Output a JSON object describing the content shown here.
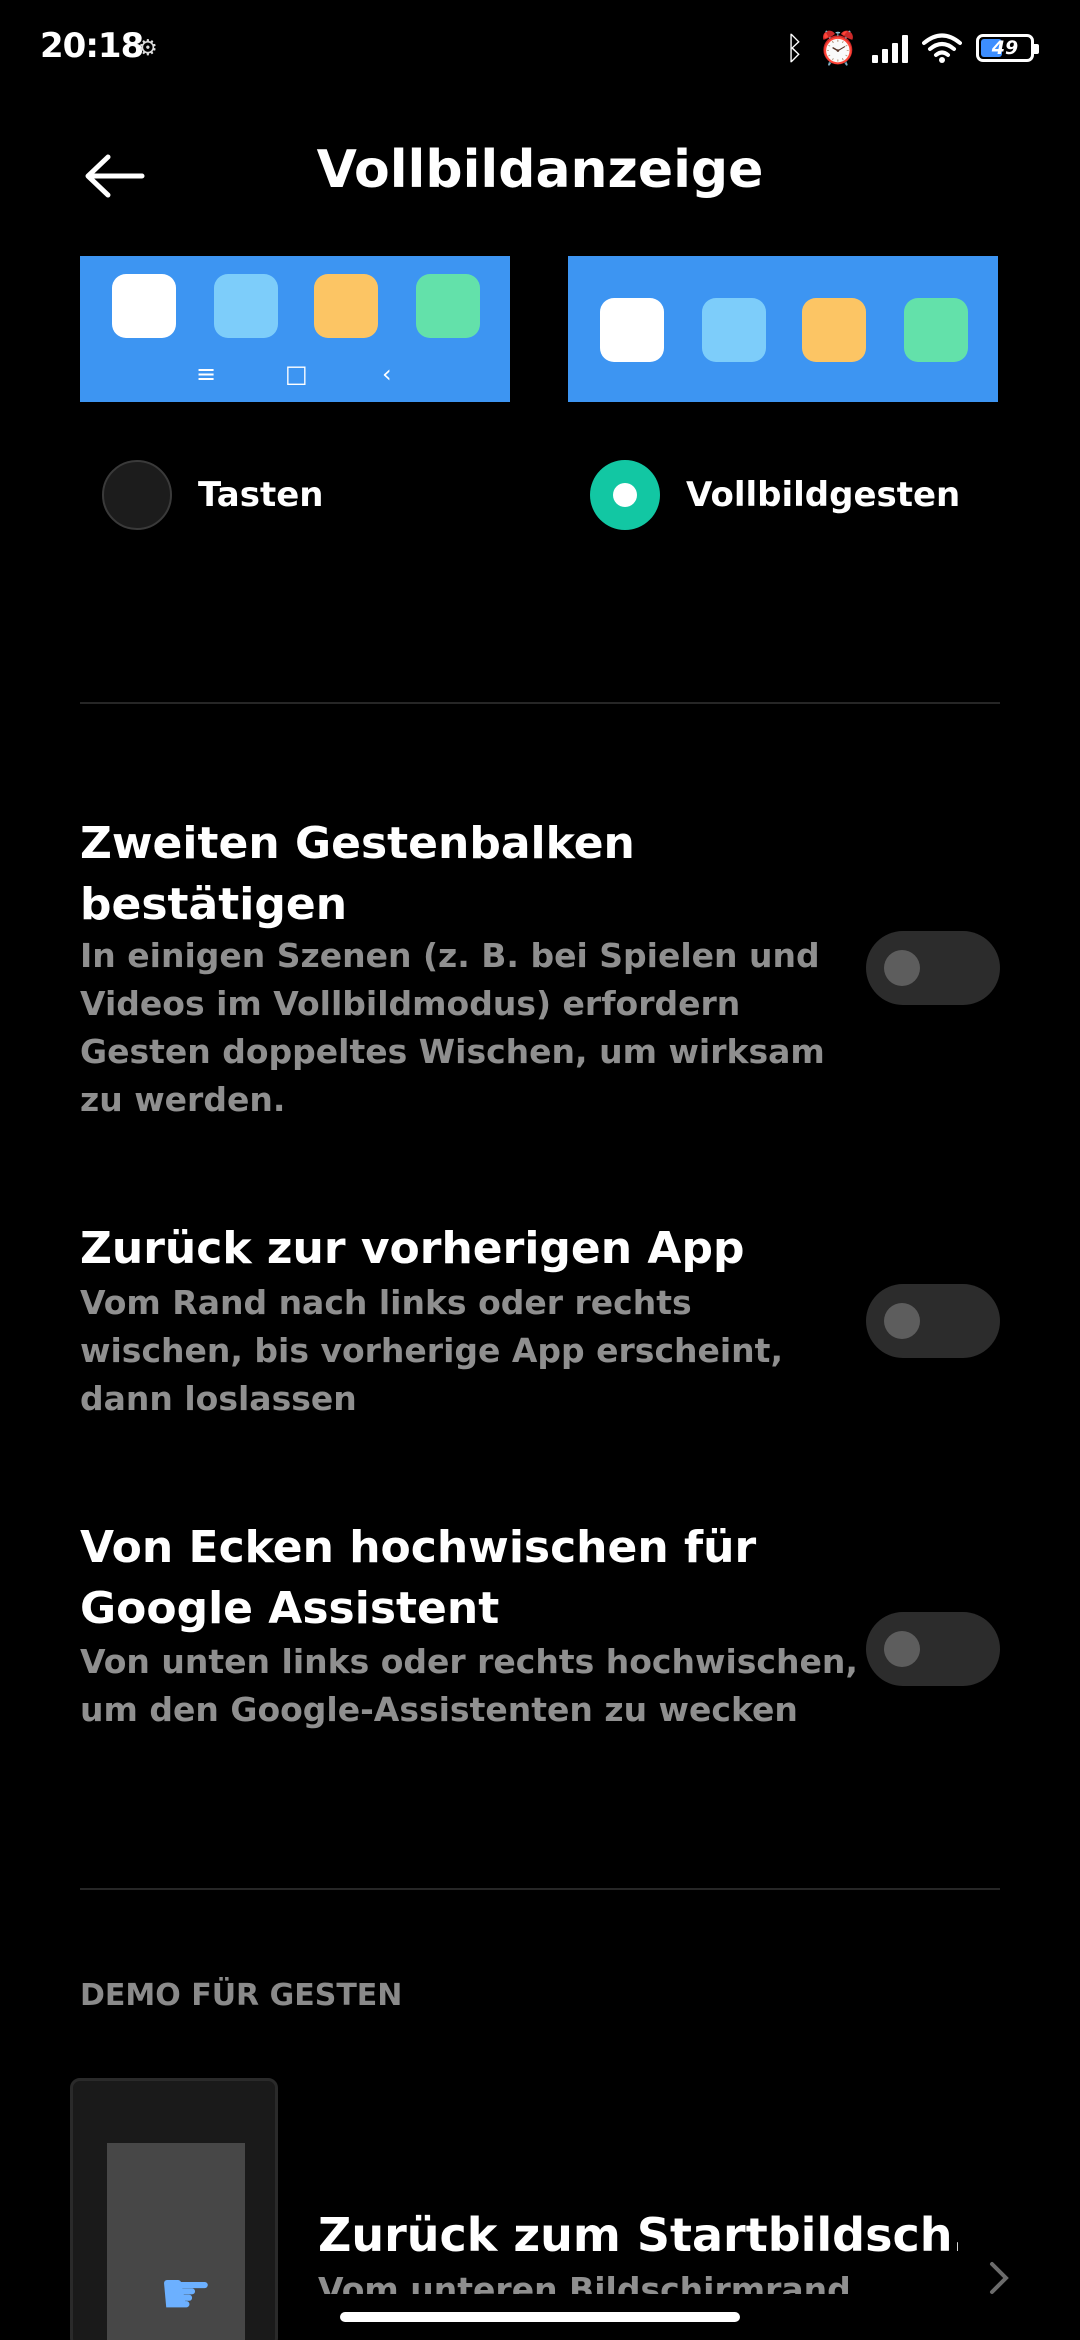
{
  "status_bar": {
    "time": "20:18",
    "battery_level": "49",
    "icons": [
      "bluetooth-icon",
      "alarm-icon",
      "signal-icon",
      "wifi-icon",
      "battery-icon"
    ]
  },
  "header": {
    "title": "Vollbildanzeige",
    "back_icon": "arrow-left-icon"
  },
  "navigation_mode": {
    "options": [
      {
        "label": "Tasten",
        "selected": false
      },
      {
        "label": "Vollbildgesten",
        "selected": true
      }
    ],
    "preview_nav_keys": [
      "≡",
      "□",
      "‹"
    ],
    "accent_color": "#12c7a3",
    "preview_color": "#3d95f2"
  },
  "settings": [
    {
      "title": "Zweiten Gestenbalken bestätigen",
      "description": "In einigen Szenen (z. B. bei Spielen und Videos im Vollbildmodus) erfordern Gesten doppeltes Wischen, um wirksam zu werden.",
      "enabled": false
    },
    {
      "title": "Zurück zur vorherigen App",
      "description": "Vom Rand nach links oder rechts wischen, bis vorherige App erscheint, dann loslassen",
      "enabled": false
    },
    {
      "title": "Von Ecken hochwischen für Google Assistent",
      "description": "Von unten links oder rechts hochwischen, um den Google-Assistenten zu wecken",
      "enabled": false
    }
  ],
  "demo_section": {
    "header": "DEMO FÜR GESTEN",
    "items": [
      {
        "title": "Zurück zum Startbildsch..",
        "subtitle": "Vom unteren Bildschirmrand"
      }
    ]
  }
}
